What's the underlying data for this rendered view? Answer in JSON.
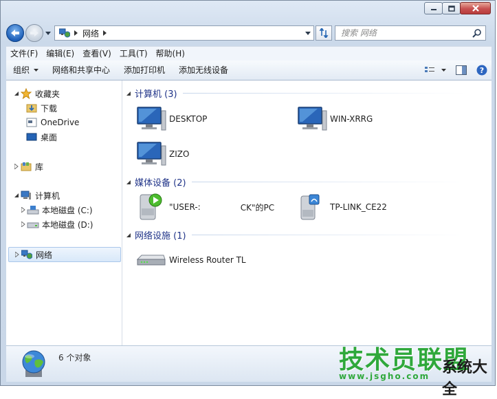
{
  "window": {
    "caption_buttons": {
      "minimize": "minimize",
      "maximize": "maximize",
      "close": "close"
    }
  },
  "address_bar": {
    "breadcrumb": [
      "网络"
    ],
    "search_placeholder": "搜索 网络"
  },
  "menu": [
    "文件(F)",
    "编辑(E)",
    "查看(V)",
    "工具(T)",
    "帮助(H)"
  ],
  "commands": {
    "organize": "组织",
    "network_center": "网络和共享中心",
    "add_printer": "添加打印机",
    "add_wireless": "添加无线设备"
  },
  "nav": {
    "favorites": "收藏夹",
    "downloads": "下载",
    "onedrive": "OneDrive",
    "desktop": "桌面",
    "libraries": "库",
    "computer": "计算机",
    "disk_c": "本地磁盘 (C:)",
    "disk_d": "本地磁盘 (D:)",
    "network": "网络"
  },
  "groups": {
    "computers": {
      "title": "计算机 (3)",
      "items": [
        "DESKTOP",
        "WIN-XRRG",
        "ZIZO"
      ]
    },
    "media": {
      "title": "媒体设备 (2)",
      "items": [
        "\"USER-:",
        "CK\"的PC",
        "TP-LINK_CE22"
      ]
    },
    "network_infra": {
      "title": "网络设施 (1)",
      "items": [
        "Wireless Router TL"
      ]
    }
  },
  "status": {
    "count_text": "6 个对象"
  },
  "watermark": {
    "title": "技术员联盟",
    "side": "系统大全",
    "url": "www.jsgho.com"
  },
  "colors": {
    "group_header": "#1e3287",
    "watermark_green": "#2fa83b",
    "selection": "#d8e8f9"
  }
}
